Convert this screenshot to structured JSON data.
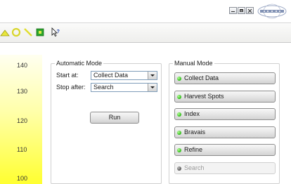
{
  "window": {
    "minimize": "minimize",
    "maximize": "maximize",
    "close": "close"
  },
  "toolbar": {
    "icons": [
      "triangle-icon",
      "circle-icon",
      "line-icon",
      "square-icon",
      "help-cursor-icon"
    ]
  },
  "scale": {
    "ticks": [
      "140",
      "130",
      "120",
      "110",
      "100"
    ]
  },
  "automatic_mode": {
    "title": "Automatic Mode",
    "start_label": "Start at:",
    "start_value": "Collect Data",
    "stop_label": "Stop after:",
    "stop_value": "Search",
    "run_label": "Run"
  },
  "manual_mode": {
    "title": "Manual Mode",
    "buttons": [
      {
        "label": "Collect Data",
        "state": "enabled"
      },
      {
        "label": "Harvest Spots",
        "state": "enabled"
      },
      {
        "label": "Index",
        "state": "enabled"
      },
      {
        "label": "Bravais",
        "state": "enabled"
      },
      {
        "label": "Refine",
        "state": "enabled"
      },
      {
        "label": "Search",
        "state": "disabled"
      }
    ]
  },
  "colors": {
    "accent_green": "#29b814",
    "scale_yellow": "#ffff30",
    "toolbar_yellow": "#e8e63a",
    "toolbar_green": "#2aa52a"
  }
}
